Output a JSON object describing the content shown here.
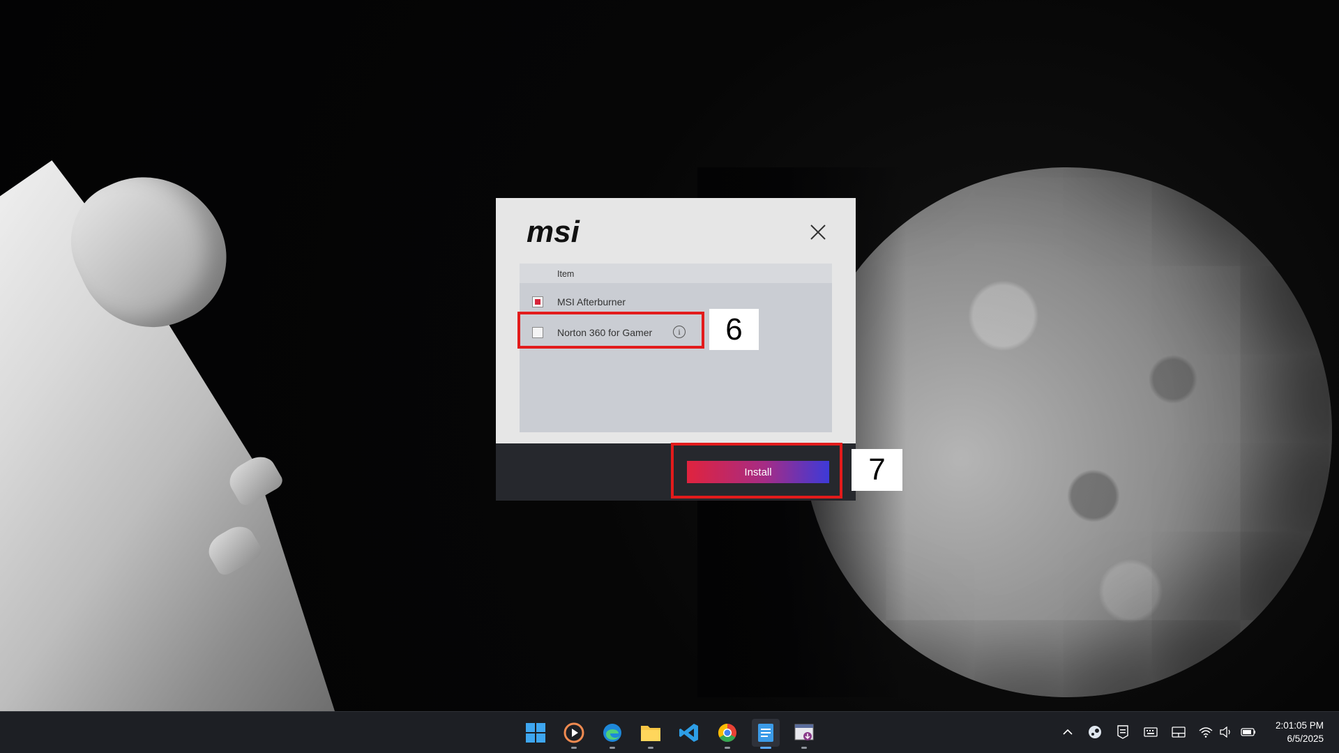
{
  "dialog": {
    "logo_text": "msi",
    "list_header": "Item",
    "items": [
      {
        "label": "MSI Afterburner",
        "checked": true
      },
      {
        "label": "Norton 360 for Gamer",
        "checked": false,
        "has_info": true
      }
    ],
    "info_symbol": "i",
    "install_label": "Install"
  },
  "annotations": [
    {
      "number": "6"
    },
    {
      "number": "7"
    }
  ],
  "taskbar": {
    "apps": [
      {
        "name": "start-icon"
      },
      {
        "name": "media-player-icon"
      },
      {
        "name": "edge-icon"
      },
      {
        "name": "file-explorer-icon"
      },
      {
        "name": "vscode-icon"
      },
      {
        "name": "chrome-icon"
      },
      {
        "name": "notepad-icon",
        "active": true
      },
      {
        "name": "installer-icon"
      }
    ],
    "tray": [
      "chevron-up-icon",
      "steam-icon",
      "epic-games-icon",
      "keyboard-icon",
      "tablet-mode-icon",
      "wifi-icon",
      "volume-icon",
      "battery-icon"
    ],
    "time": "2:01:05 PM",
    "date": "6/5/2025"
  },
  "colors": {
    "annotation_red": "#e21b1b",
    "checkbox_red": "#d7243a",
    "install_gradient_start": "#e0233e",
    "install_gradient_end": "#3d3ad8"
  }
}
